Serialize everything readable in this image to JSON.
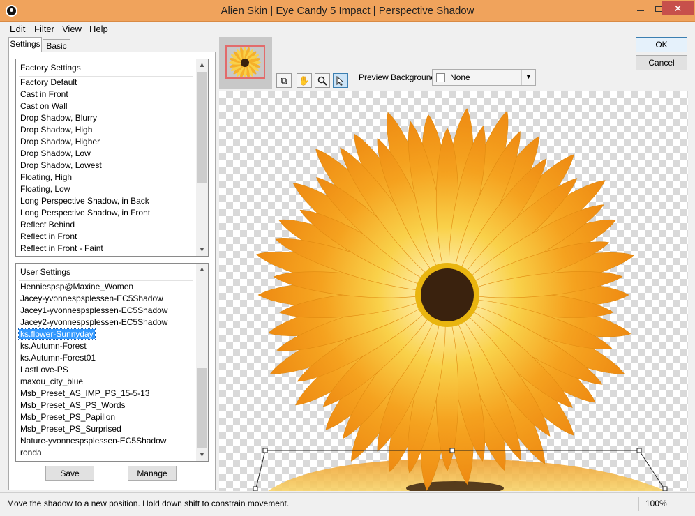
{
  "window": {
    "title": "Alien Skin | Eye Candy 5 Impact | Perspective Shadow"
  },
  "menu": [
    "Edit",
    "Filter",
    "View",
    "Help"
  ],
  "tabs": {
    "settings": "Settings",
    "basic": "Basic"
  },
  "factory_settings": {
    "header": "Factory Settings",
    "items": [
      "Factory Default",
      "Cast in Front",
      "Cast on Wall",
      "Drop Shadow, Blurry",
      "Drop Shadow, High",
      "Drop Shadow, Higher",
      "Drop Shadow, Low",
      "Drop Shadow, Lowest",
      "Floating, High",
      "Floating, Low",
      "Long Perspective Shadow, in Back",
      "Long Perspective Shadow, in Front",
      "Reflect Behind",
      "Reflect in Front",
      "Reflect in Front - Faint"
    ]
  },
  "user_settings": {
    "header": "User Settings",
    "selected": "ks.flower-Sunnyday",
    "items": [
      "Henniespsp@Maxine_Women",
      "Jacey-yvonnespsplessen-EC5Shadow",
      "Jacey1-yvonnespsplessen-EC5Shadow",
      "Jacey2-yvonnespsplessen-EC5Shadow",
      "ks.flower-Sunnyday",
      "ks.Autumn-Forest",
      "ks.Autumn-Forest01",
      "LastLove-PS",
      "maxou_city_blue",
      "Msb_Preset_AS_IMP_PS_15-5-13",
      "Msb_Preset_AS_PS_Words",
      "Msb_Preset_PS_Papillon",
      "Msb_Preset_PS_Surprised",
      "Nature-yvonnespsplessen-EC5Shadow",
      "ronda"
    ]
  },
  "buttons": {
    "save": "Save",
    "manage": "Manage",
    "ok": "OK",
    "cancel": "Cancel"
  },
  "preview": {
    "background_label": "Preview Background:",
    "background_value": "None"
  },
  "status": {
    "message": "Move the shadow to a new position. Hold down shift to constrain movement.",
    "zoom": "100%"
  },
  "colors": {
    "titlebar": "#f0a35c",
    "close_button": "#c7504b",
    "selection": "#3399ff",
    "petal": "#f3a21f",
    "flower_center": "#3a220e"
  }
}
